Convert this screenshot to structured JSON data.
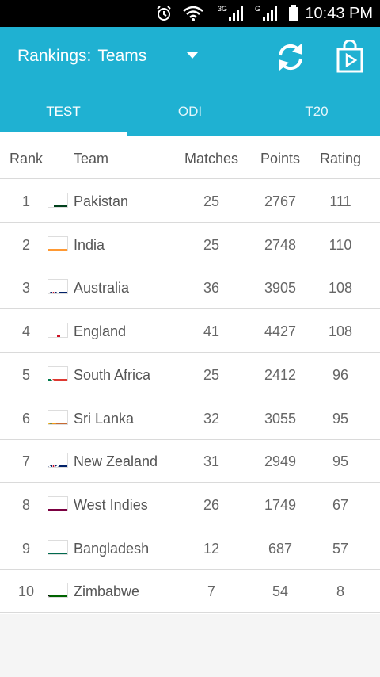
{
  "status_bar": {
    "time": "10:43 PM",
    "network_1": "3G",
    "network_2": "G"
  },
  "header": {
    "title": "Rankings:",
    "selection": "Teams"
  },
  "tabs": [
    {
      "label": "TEST",
      "active": true
    },
    {
      "label": "ODI",
      "active": false
    },
    {
      "label": "T20",
      "active": false
    }
  ],
  "table": {
    "columns": [
      "Rank",
      "Team",
      "Matches",
      "Points",
      "Rating"
    ],
    "rows": [
      {
        "rank": "1",
        "team": "Pakistan",
        "flag": "pakistan-flag-icon",
        "matches": "25",
        "points": "2767",
        "rating": "111"
      },
      {
        "rank": "2",
        "team": "India",
        "flag": "india-flag-icon",
        "matches": "25",
        "points": "2748",
        "rating": "110"
      },
      {
        "rank": "3",
        "team": "Australia",
        "flag": "australia-flag-icon",
        "matches": "36",
        "points": "3905",
        "rating": "108"
      },
      {
        "rank": "4",
        "team": "England",
        "flag": "england-flag-icon",
        "matches": "41",
        "points": "4427",
        "rating": "108"
      },
      {
        "rank": "5",
        "team": "South Africa",
        "flag": "south-africa-flag-icon",
        "matches": "25",
        "points": "2412",
        "rating": "96"
      },
      {
        "rank": "6",
        "team": "Sri Lanka",
        "flag": "sri-lanka-flag-icon",
        "matches": "32",
        "points": "3055",
        "rating": "95"
      },
      {
        "rank": "7",
        "team": "New Zealand",
        "flag": "new-zealand-flag-icon",
        "matches": "31",
        "points": "2949",
        "rating": "95"
      },
      {
        "rank": "8",
        "team": "West Indies",
        "flag": "west-indies-flag-icon",
        "matches": "26",
        "points": "1749",
        "rating": "67"
      },
      {
        "rank": "9",
        "team": "Bangladesh",
        "flag": "bangladesh-flag-icon",
        "matches": "12",
        "points": "687",
        "rating": "57"
      },
      {
        "rank": "10",
        "team": "Zimbabwe",
        "flag": "zimbabwe-flag-icon",
        "matches": "7",
        "points": "54",
        "rating": "8"
      }
    ]
  },
  "colors": {
    "accent": "#1fb1d2",
    "text": "#555555",
    "divider": "#dadada"
  }
}
